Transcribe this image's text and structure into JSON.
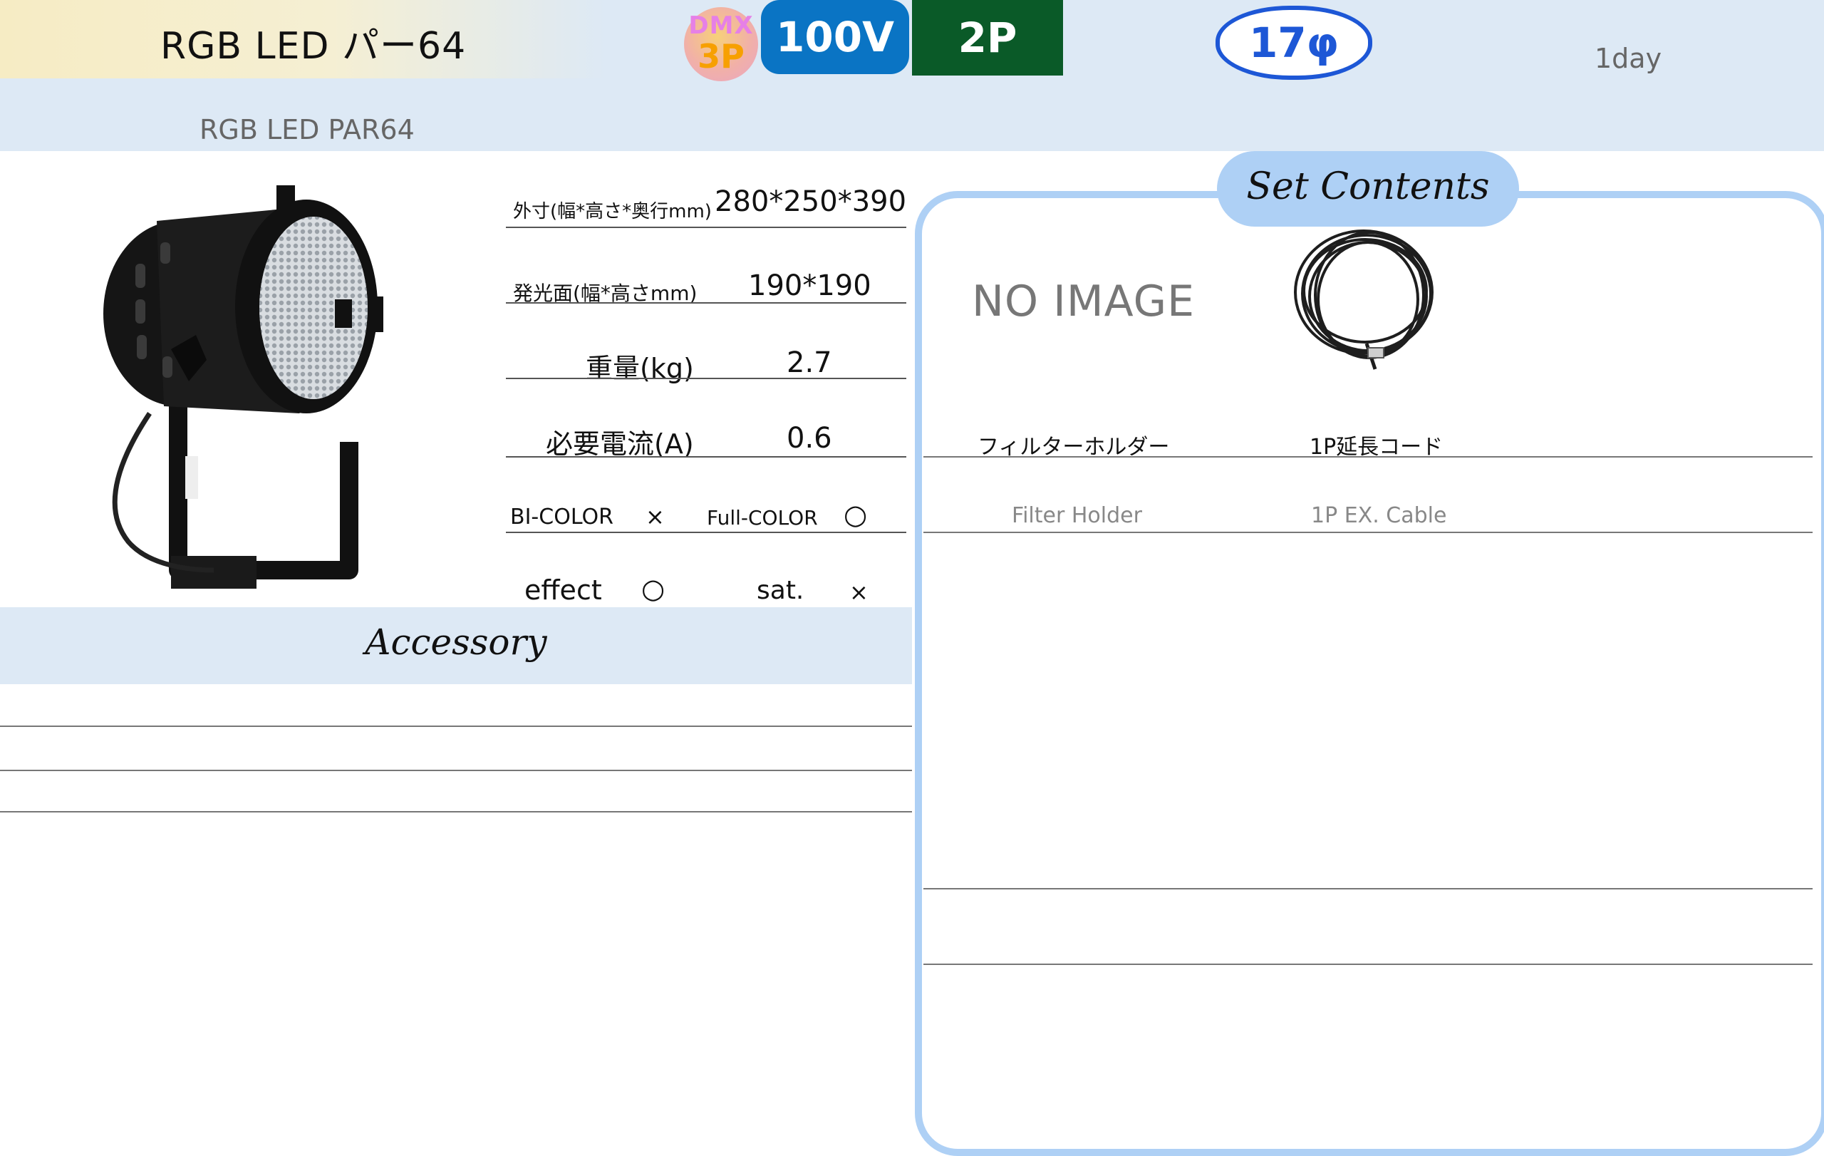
{
  "header": {
    "title": "RGB LED パー64",
    "subtitle": "RGB LED PAR64",
    "rental_period": "1day",
    "badges": {
      "dmx_top": "DMX",
      "dmx_bottom": "3P",
      "voltage": "100V",
      "plug": "2P",
      "diameter": "17φ"
    }
  },
  "specs": {
    "size_label": "外寸(幅*高さ*奥行mm)",
    "size_value": "280*250*390",
    "face_label": "発光面(幅*高さmm)",
    "face_value": "190*190",
    "weight_label": "重量(kg)",
    "weight_value": "2.7",
    "current_label": "必要電流(A)",
    "current_value": "0.6",
    "bicolor_label": "BI-COLOR",
    "bicolor_value": "×",
    "fullcolor_label": "Full-COLOR",
    "fullcolor_value": "○",
    "effect_label": "effect",
    "effect_value": "○",
    "sat_label": "sat.",
    "sat_value": "×"
  },
  "accessory": {
    "title": "Accessory"
  },
  "set_contents": {
    "title": "Set Contents",
    "items": [
      {
        "name": "フィルターホルダー",
        "name_en": "Filter Holder",
        "image": "NO IMAGE"
      },
      {
        "name": "1P延長コード",
        "name_en": "1P EX. Cable",
        "image": "cable-coil"
      }
    ]
  },
  "colors": {
    "header_bg": "#dde9f5",
    "panel_border": "#aed0f5",
    "voltage_badge": "#0a74c4",
    "plug_badge": "#0a5a28",
    "diameter_badge": "#1d57d6"
  }
}
